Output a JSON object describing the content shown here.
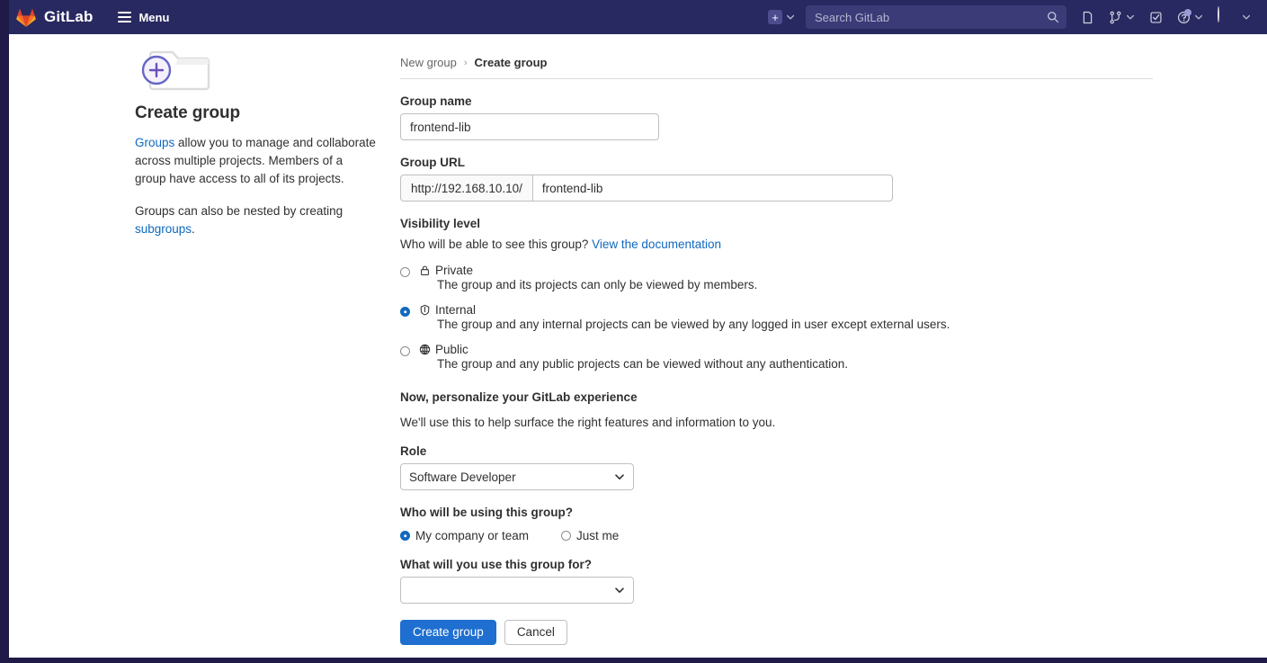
{
  "topbar": {
    "brand_name": "GitLab",
    "menu_label": "Menu",
    "new_icon": "plus-square-icon",
    "new_chevron_icon": "chevron-down-icon",
    "search": {
      "placeholder": "Search GitLab",
      "value": "",
      "icon": "search-icon"
    },
    "icons": [
      {
        "name": "issues-icon",
        "has_chevron": false
      },
      {
        "name": "merge-requests-icon",
        "has_chevron": true
      },
      {
        "name": "todos-icon",
        "has_chevron": false
      },
      {
        "name": "help-icon",
        "has_chevron": true
      }
    ],
    "avatar": {
      "name": "user-avatar",
      "chevron_icon": "chevron-down-icon"
    }
  },
  "aside": {
    "icon": "new-folder-icon",
    "title": "Create group",
    "paragraph1": {
      "link": "Groups",
      "rest": " allow you to manage and collaborate across multiple projects. Members of a group have access to all of its projects."
    },
    "paragraph2": {
      "lead": "Groups can also be nested by creating ",
      "link": "subgroups",
      "tail": "."
    }
  },
  "breadcrumb": {
    "parent": "New group",
    "separator": "›",
    "current": "Create group"
  },
  "form": {
    "group_name": {
      "label": "Group name",
      "value": "frontend-lib",
      "placeholder": ""
    },
    "group_url": {
      "label": "Group URL",
      "prefix": "http://192.168.10.10/",
      "value": "frontend-lib",
      "placeholder": ""
    },
    "visibility": {
      "label": "Visibility level",
      "helper_text": "Who will be able to see this group?",
      "helper_link": "View the documentation",
      "options": [
        {
          "value": "private",
          "icon": "lock-icon",
          "title": "Private",
          "description": "The group and its projects can only be viewed by members.",
          "checked": false
        },
        {
          "value": "internal",
          "icon": "shield-icon",
          "title": "Internal",
          "description": "The group and any internal projects can be viewed by any logged in user except external users.",
          "checked": true
        },
        {
          "value": "public",
          "icon": "globe-icon",
          "title": "Public",
          "description": "The group and any public projects can be viewed without any authentication.",
          "checked": false
        }
      ]
    },
    "personalize": {
      "heading": "Now, personalize your GitLab experience",
      "subtext": "We'll use this to help surface the right features and information to you."
    },
    "role": {
      "label": "Role",
      "selected": "Software Developer",
      "options": [
        "Software Developer"
      ]
    },
    "who_using": {
      "label": "Who will be using this group?",
      "options": [
        {
          "value": "company",
          "label": "My company or team",
          "checked": true
        },
        {
          "value": "personal",
          "label": "Just me",
          "checked": false
        }
      ]
    },
    "use_for": {
      "label": "What will you use this group for?",
      "selected": "",
      "options": [
        ""
      ]
    },
    "actions": {
      "submit": "Create group",
      "cancel": "Cancel"
    }
  },
  "colors": {
    "navbar": "#292961",
    "primary_button": "#1f6fd0",
    "link": "#1068bf",
    "accent_purple": "#6666c4"
  }
}
